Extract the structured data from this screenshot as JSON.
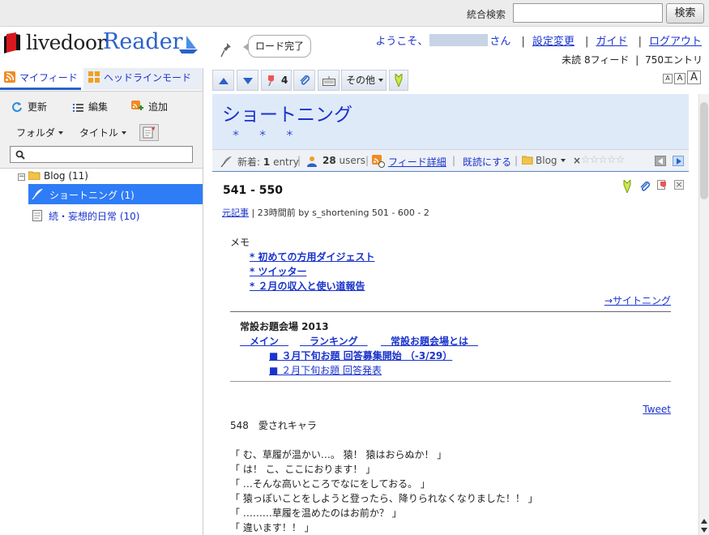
{
  "topbar": {
    "search_label": "統合検索",
    "search_value": "",
    "search_button": "検索"
  },
  "logo": {
    "part1": "livedoor",
    "part2": "Reader"
  },
  "status_bubble": "ロード完了",
  "usernav": {
    "welcome": "ようこそ、",
    "san": "さん",
    "settings": "設定変更",
    "guide": "ガイド",
    "logout": "ログアウト"
  },
  "counts": {
    "unread": "未読 8フィード",
    "sep": "|",
    "entries": "750エントリ"
  },
  "left_tabs": {
    "myfeed": "マイフィード",
    "headline": "ヘッドラインモード"
  },
  "left_toolbar": {
    "refresh": "更新",
    "edit": "編集",
    "add": "追加",
    "folder": "フォルダ",
    "title": "タイトル",
    "filter_value": ""
  },
  "tree": {
    "folder": "Blog (11)",
    "items": [
      {
        "label": "ショートニング (1)"
      },
      {
        "label": "続・妄想的日常 (10)"
      }
    ]
  },
  "right_toolbar": {
    "pin_count": "4",
    "other": "その他"
  },
  "feed": {
    "title": "ショートニング",
    "stars": "＊ ＊ ＊",
    "info": {
      "new": "新着:",
      "entry_count": "1",
      "entry_word": "entry",
      "users_count": "28",
      "users_word": "users",
      "detail": "フィード詳細",
      "mark_read": "既読にする",
      "folder": "Blog"
    }
  },
  "entry": {
    "title": "541 - 550",
    "source_link": "元記事",
    "meta": "| 23時間前 by s_shortening 501 - 600 - 2",
    "memo_label": "メモ",
    "memo_links": [
      "* 初めての方用ダイジェスト",
      "* ツイッター",
      "* ２月の収入と使い道報告"
    ],
    "sightening": "→サイトニング",
    "venue_title": "常設お題会場 2013",
    "venue_nav": [
      "　メイン　",
      "　ランキング　",
      "　常設お題会場とは　"
    ],
    "venue_items": [
      "■ ３月下旬お題 回答募集開始 （-3/29）",
      "■ ２月下旬お題 回答発表"
    ],
    "tweet": "Tweet",
    "story_title": "548　愛されキャラ",
    "lines": [
      "「 む、草履が温かい…。 猿！ 猿はおらぬか！ 」",
      "「 は！ こ、ここにおります！ 」",
      "「 …そんな高いところでなにをしておる。 」",
      "「 猿っぽいことをしようと登ったら、降りられなくなりました！！ 」",
      "「 ………草履を温めたのはお前か？ 」",
      "「 違います！！ 」"
    ]
  }
}
